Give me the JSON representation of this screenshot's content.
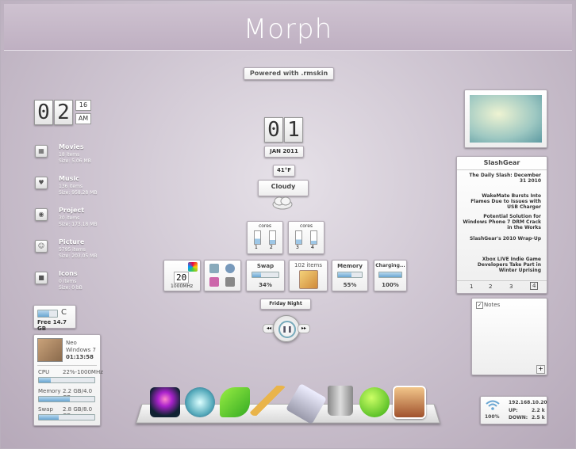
{
  "title": "Morph",
  "powered": "Powered with .rmskin",
  "clock": {
    "h1": "0",
    "h2": "2",
    "minutes": "16",
    "ampm": "AM"
  },
  "folders": [
    {
      "name": "Movies",
      "line1": "18 items",
      "line2": "Size: 5.06 MB",
      "icon": "film-icon"
    },
    {
      "name": "Music",
      "line1": "136 items",
      "line2": "Size: 958.28 MB",
      "icon": "heart-icon"
    },
    {
      "name": "Project",
      "line1": "30 items",
      "line2": "Size: 173.18 MB",
      "icon": "disc-icon"
    },
    {
      "name": "Picture",
      "line1": "5795 items",
      "line2": "Size: 203.05 MB",
      "icon": "smiley-icon"
    },
    {
      "name": "Icons",
      "line1": "0 items",
      "line2": "Size: 0 bB",
      "icon": "square-icon"
    }
  ],
  "disk": {
    "label": "Free 14.7 GB",
    "drive": "C",
    "used_fraction": 0.6
  },
  "sysinfo": {
    "user": "Neo",
    "os": "Windows 7",
    "uptime": "01:13:58",
    "cpu_label": "CPU",
    "cpu_value": "22%-1000MHz",
    "cpu_fraction": 0.22,
    "mem_label": "Memory",
    "mem_value": "2.2 GB/4.0 GB",
    "mem_fraction": 0.55,
    "swap_label": "Swap",
    "swap_value": "2.8 GB/8.0 GB",
    "swap_fraction": 0.35
  },
  "date": {
    "d1": "0",
    "d2": "1",
    "month": "JAN 2011"
  },
  "weather": {
    "temp": "41°F",
    "cond": "Cloudy"
  },
  "cores": [
    {
      "label": "cores",
      "a": "1",
      "b": "2"
    },
    {
      "label": "cores",
      "a": "3",
      "b": "4"
    }
  ],
  "cpu_widget": {
    "value": "20",
    "freq": "1000MHz"
  },
  "swap": {
    "label": "Swap",
    "value": "34%",
    "fraction": 0.34
  },
  "recycle": {
    "label": "102 items"
  },
  "memory": {
    "label": "Memory",
    "value": "55%",
    "fraction": 0.55
  },
  "battery": {
    "label": "Charging...",
    "value": "100%",
    "fraction": 1.0
  },
  "media": {
    "playlist": "Friday Night"
  },
  "feed": {
    "title": "SlashGear",
    "items": [
      "The Daily Slash: December 31 2010",
      "WakeMate Bursts Into Flames Due to Issues with USB Charger",
      "Potential Solution for Windows Phone 7 DRM Crack in the Works",
      "SlashGear's 2010 Wrap-Up",
      "Xbox LIVE Indie Game Developers Take Part in Winter Uprising"
    ],
    "pages": [
      "1",
      "2",
      "3",
      "4"
    ]
  },
  "notes": {
    "title": "Notes",
    "add": "+"
  },
  "network": {
    "ip": "192.168.10.20",
    "up_label": "UP:",
    "up": "2.2 k",
    "down_label": "DOWN:",
    "down": "2.5 k",
    "signal": "100%"
  },
  "dock": [
    "magic-hat-icon",
    "safari-icon",
    "leaf-icon",
    "pencil-icon",
    "usb-drive-icon",
    "trash-icon",
    "apple-icon",
    "portrait-icon"
  ]
}
